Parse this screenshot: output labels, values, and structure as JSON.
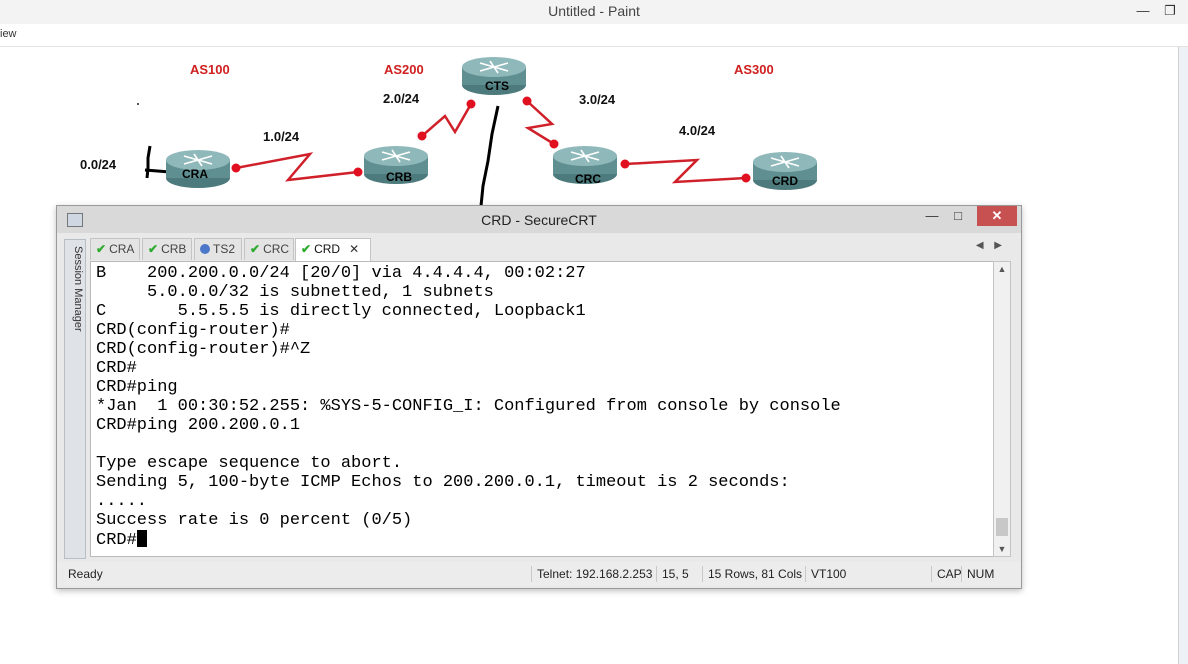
{
  "paint": {
    "title": "Untitled - Paint",
    "menu_view": "iew",
    "ctrl_minimize": "—",
    "ctrl_restore": "❐"
  },
  "diagram": {
    "as_labels": [
      "AS100",
      "AS200",
      "AS300"
    ],
    "net_labels": [
      "0.0/24",
      "1.0/24",
      "2.0/24",
      "3.0/24",
      "4.0/24"
    ],
    "routers": [
      "CRA",
      "CRB",
      "CTS",
      "CRC",
      "CRD"
    ],
    "colors": {
      "link": "#d0202a",
      "as_label": "#d02020",
      "router_body": "#6a9a9c"
    }
  },
  "crt": {
    "title": "CRD - SecureCRT",
    "session_manager": "Session Manager",
    "ctrl_minimize": "—",
    "ctrl_maximize": "□",
    "ctrl_close": "✕",
    "tabs": [
      "CRA",
      "CRB",
      "TS2",
      "CRC",
      "CRD"
    ],
    "active_tab": "CRD",
    "tab_close": "✕",
    "tab_prev": "◀",
    "tab_next": "▶",
    "terminal_lines": [
      "B    200.200.0.0/24 [20/0] via 4.4.4.4, 00:02:27",
      "     5.0.0.0/32 is subnetted, 1 subnets",
      "C       5.5.5.5 is directly connected, Loopback1",
      "CRD(config-router)#",
      "CRD(config-router)#^Z",
      "CRD#",
      "CRD#ping",
      "*Jan  1 00:30:52.255: %SYS-5-CONFIG_I: Configured from console by console",
      "CRD#ping 200.200.0.1",
      "",
      "Type escape sequence to abort.",
      "Sending 5, 100-byte ICMP Echos to 200.200.0.1, timeout is 2 seconds:",
      ".....",
      "Success rate is 0 percent (0/5)",
      "CRD#"
    ],
    "status": {
      "ready": "Ready",
      "connection": "Telnet: 192.168.2.253",
      "position": "15,  5",
      "size": "15 Rows, 81 Cols",
      "emulation": "VT100",
      "caps": "CAP",
      "num": "NUM"
    }
  }
}
